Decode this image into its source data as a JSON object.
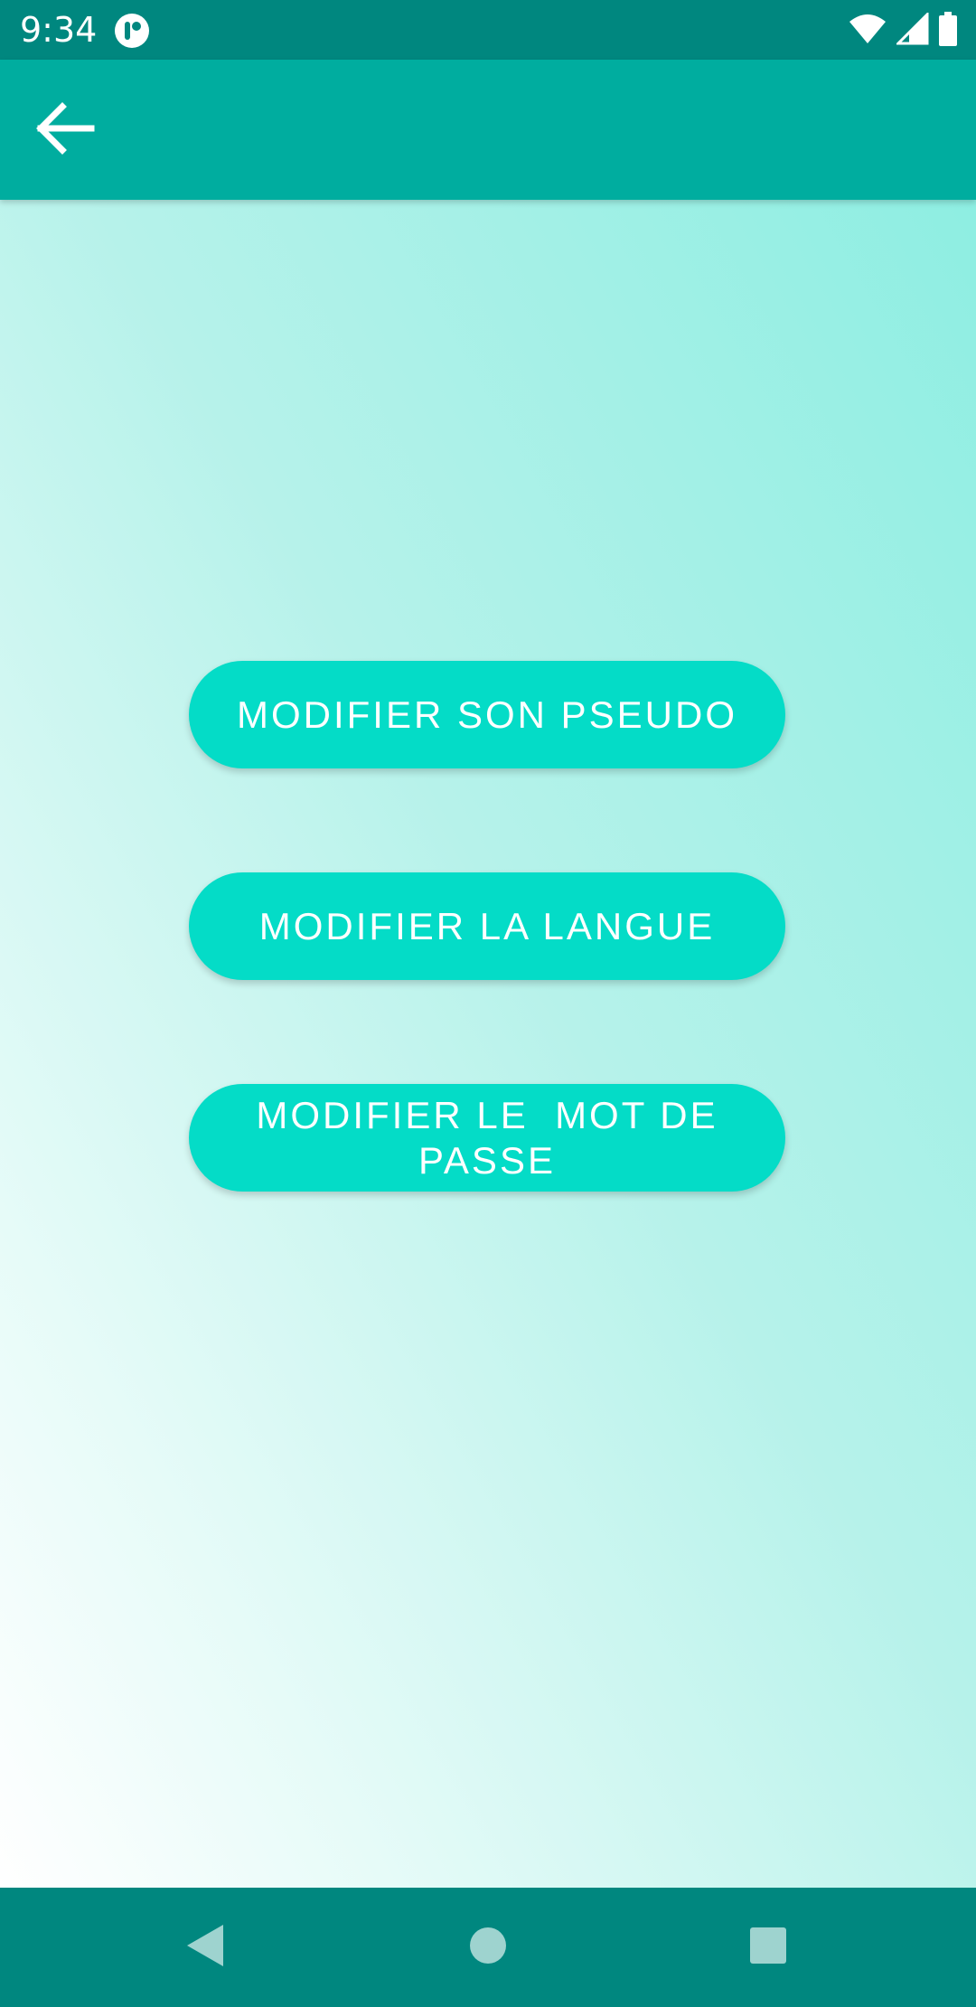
{
  "status_bar": {
    "time": "9:34",
    "icons": {
      "app": "app-notification-icon",
      "wifi": "wifi-icon",
      "signal": "cell-signal-icon",
      "battery": "battery-icon"
    }
  },
  "app_bar": {
    "back_icon": "arrow-back-icon"
  },
  "buttons": {
    "change_nickname": "MODIFIER SON PSEUDO",
    "change_language": "MODIFIER LA LANGUE",
    "change_password": "MODIFIER LE  MOT DE PASSE"
  },
  "nav_bar": {
    "back_icon": "nav-back-icon",
    "home_icon": "nav-home-icon",
    "recents_icon": "nav-recents-icon"
  },
  "colors": {
    "status_bar": "#00877f",
    "app_bar": "#00ad9f",
    "button": "#04dcc7",
    "nav_bar": "#00877f"
  }
}
